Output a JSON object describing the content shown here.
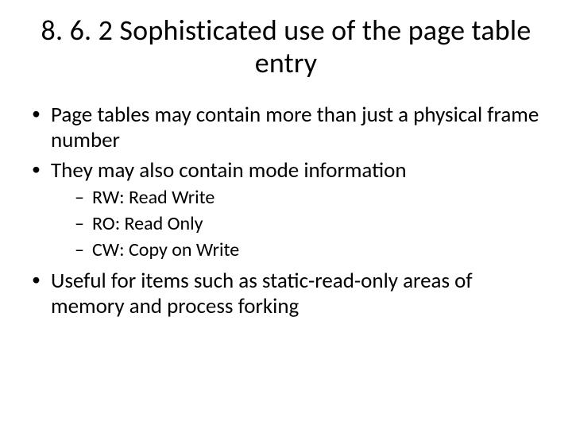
{
  "title": "8. 6. 2 Sophisticated use of the page table entry",
  "bullets": {
    "b0": "Page tables may contain more than just a physical frame number",
    "b1": "They may also contain mode information",
    "sub": {
      "s0": "RW: Read Write",
      "s1": "RO: Read Only",
      "s2": "CW: Copy on Write"
    },
    "b2": "Useful for items such as static-read-only areas of memory and process forking"
  }
}
